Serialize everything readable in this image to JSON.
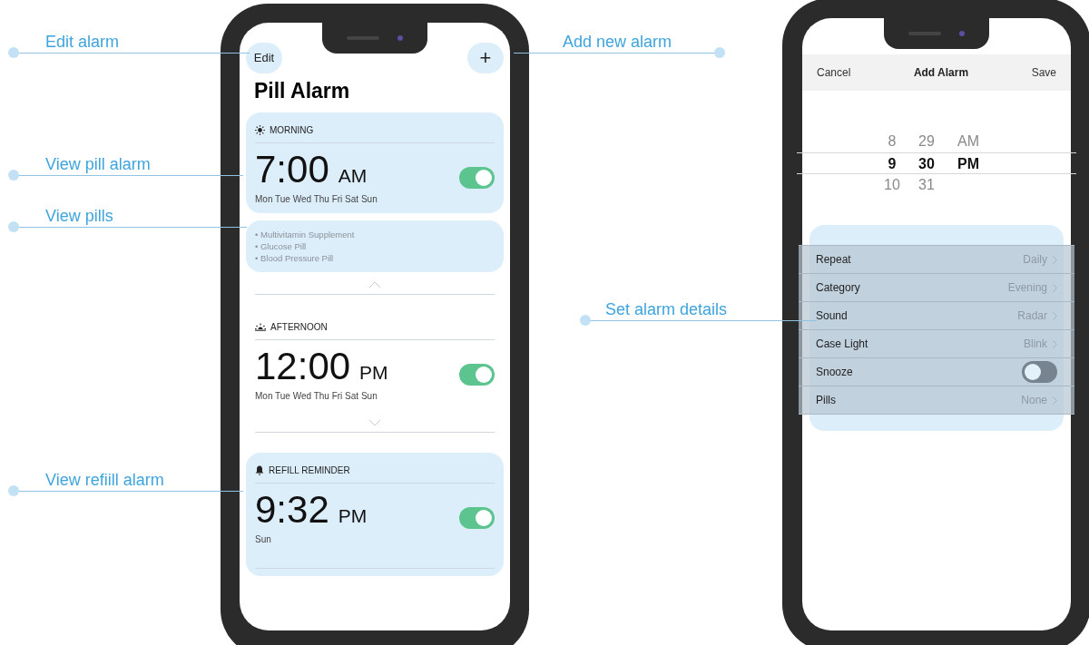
{
  "annotations": [
    {
      "label": "Edit alarm"
    },
    {
      "label": "View pill alarm"
    },
    {
      "label": "View pills"
    },
    {
      "label": "View refiill alarm"
    },
    {
      "label": "Add new alarm"
    },
    {
      "label": "Set alarm details"
    }
  ],
  "alarm_list": {
    "edit": "Edit",
    "add": "+",
    "title": "Pill Alarm",
    "alarms": [
      {
        "kind": "sun",
        "category": "MORNING",
        "time": "7:00",
        "period": "AM",
        "days": "Mon Tue Wed Thu Fri Sat Sun",
        "on": true,
        "highlighted": true,
        "expanded": true,
        "pills": [
          "• Multivitamin Supplement",
          "• Glucose Pill",
          "• Blood Pressure Pill"
        ]
      },
      {
        "kind": "sunrise",
        "category": "AFTERNOON",
        "time": "12:00",
        "period": "PM",
        "days": "Mon Tue Wed Thu Fri Sat Sun",
        "on": true,
        "highlighted": false,
        "expanded": false
      },
      {
        "kind": "bell",
        "category": "REFILL REMINDER",
        "time": "9:32",
        "period": "PM",
        "days": "Sun",
        "on": true,
        "highlighted": true
      }
    ]
  },
  "add_alarm": {
    "cancel": "Cancel",
    "title": "Add Alarm",
    "save": "Save",
    "picker_rows": [
      {
        "cells": [
          "8",
          "29",
          "AM"
        ],
        "selected": false
      },
      {
        "cells": [
          "9",
          "30",
          "PM"
        ],
        "selected": true
      },
      {
        "cells": [
          "10",
          "31"
        ],
        "selected": false
      }
    ],
    "settings": [
      {
        "kind": "link",
        "label": "Repeat",
        "value": "Daily"
      },
      {
        "kind": "link",
        "label": "Category",
        "value": "Evening"
      },
      {
        "kind": "link",
        "label": "Sound",
        "value": "Radar"
      },
      {
        "kind": "link",
        "label": "Case Light",
        "value": "Blink"
      },
      {
        "kind": "toggle",
        "label": "Snooze",
        "on": false
      },
      {
        "kind": "link",
        "label": "Pills",
        "value": "None"
      }
    ]
  }
}
